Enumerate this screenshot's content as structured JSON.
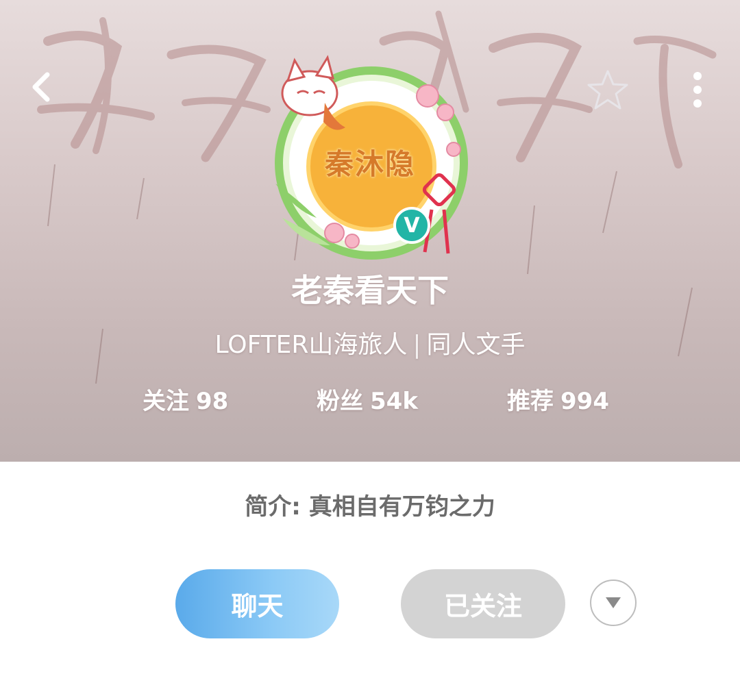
{
  "header": {
    "back_icon": "chevron-left-icon",
    "star_icon": "star-outline-icon",
    "more_icon": "more-vertical-icon"
  },
  "profile": {
    "avatar_text": "秦沐隐",
    "verified_badge": "V",
    "username": "老秦看天下",
    "tagline_left": "LOFTER山海旅人",
    "tagline_sep": "|",
    "tagline_right": "同人文手"
  },
  "stats": [
    {
      "label": "关注",
      "value": "98"
    },
    {
      "label": "粉丝",
      "value": "54k"
    },
    {
      "label": "推荐",
      "value": "994"
    }
  ],
  "bio": "简介: 真相自有万钧之力",
  "actions": {
    "chat_label": "聊天",
    "followed_label": "已关注",
    "dropdown_icon": "triangle-down-icon"
  },
  "colors": {
    "chat_gradient_start": "#5aaaea",
    "chat_gradient_end": "#a8d8f8",
    "followed_bg": "#d3d3d3",
    "verified": "#22b5a6"
  }
}
